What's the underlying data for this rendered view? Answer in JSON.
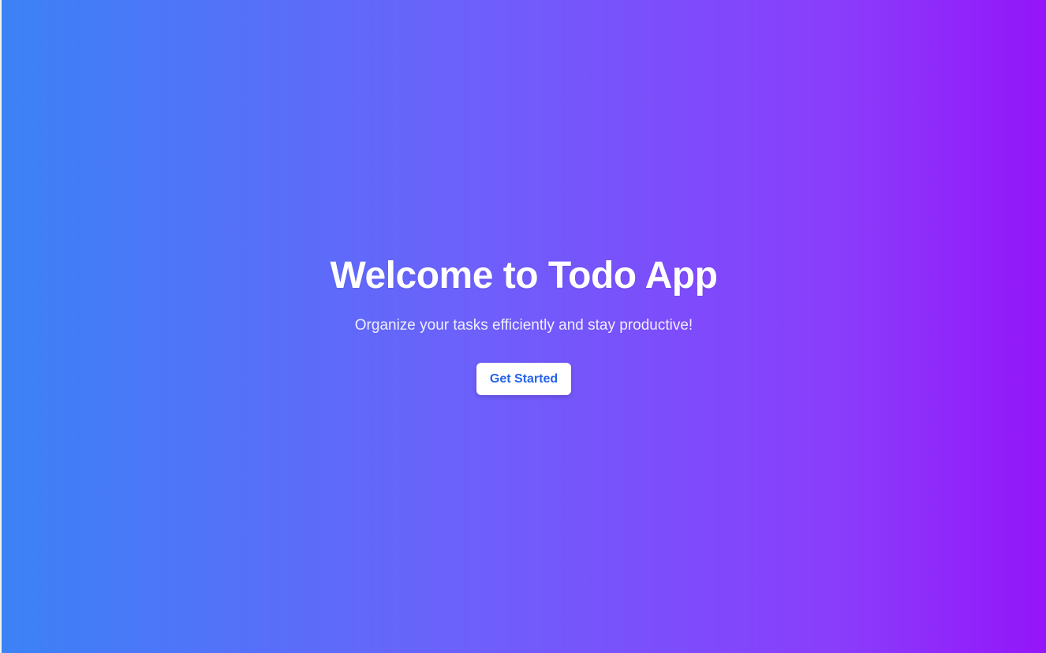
{
  "hero": {
    "title": "Welcome to Todo App",
    "subtitle": "Organize your tasks efficiently and stay productive!",
    "cta_label": "Get Started"
  },
  "colors": {
    "gradient_start": "#3b82f6",
    "gradient_end": "#9415f9",
    "button_background": "#ffffff",
    "button_text": "#2563eb",
    "title_text": "#ffffff"
  }
}
